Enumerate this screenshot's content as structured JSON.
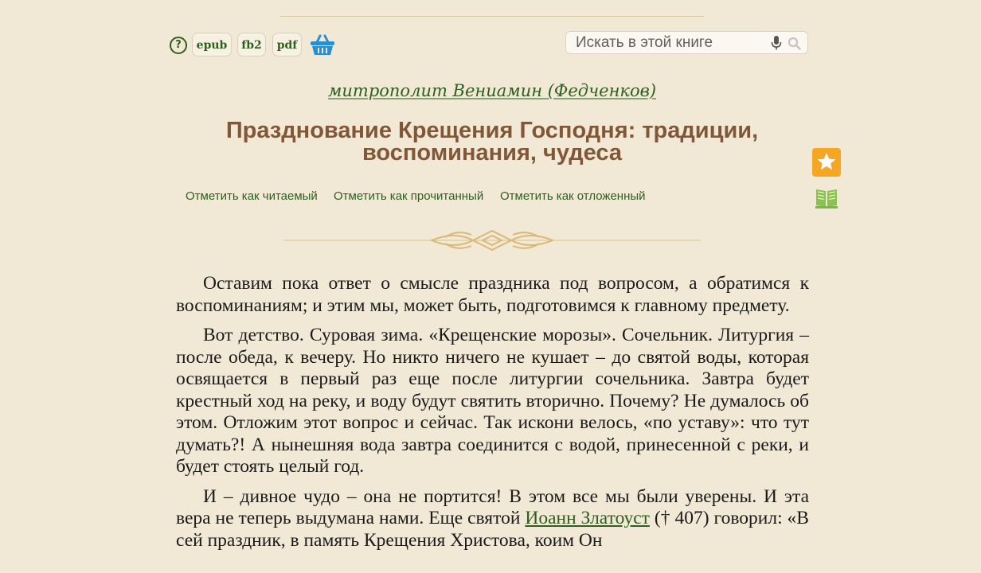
{
  "toolbar": {
    "help_icon": "question-circle-icon",
    "epub_label": "epub",
    "fb2_label": "fb2",
    "pdf_label": "pdf",
    "basket_icon": "basket-icon"
  },
  "search": {
    "placeholder": "Искать в этой книге",
    "mic_icon": "microphone-icon",
    "search_icon": "search-icon"
  },
  "book": {
    "author": "митрополит Вениамин (Федченков)",
    "title": "Празднование Крещения Господня: традиции, воспоминания, чудеса"
  },
  "actions": {
    "mark_reading": "Отметить как читаемый",
    "mark_read": "Отметить как прочитанный",
    "mark_postponed": "Отметить как отложенный",
    "favorite_icon": "star-icon",
    "reading_icon": "open-book-icon"
  },
  "content": {
    "p1": "Оставим пока ответ о смысле праздника под вопросом, а обратимся к воспоминаниям; и этим мы, может быть, подготовимся к главному предмету.",
    "p2": "Вот детство. Суровая зима. «Крещенские морозы». Сочельник. Литургия – после обеда, к вечеру. Но никто ничего не кушает – до святой воды, которая освящается в первый раз еще после литургии сочельника. Завтра будет крестный ход на реку, и воду будут святить вторично. Почему? Не думалось об этом. Отложим этот вопрос и сейчас. Так искони велось, «по уставу»: что тут думать?! А нынешняя вода завтра соединится с водой, принесенной с реки, и будет стоять целый год.",
    "p3_before": "И – дивное чудо – она не портится! В этом все мы были уверены. И эта вера не теперь выдумана нами. Еще святой ",
    "p3_link": "Иоанн Златоуст",
    "p3_after": " (†  407) говорил: «В сей праздник, в память Крещения Христова, коим Он"
  },
  "colors": {
    "background": "#f2e8d6",
    "link": "#2f5f1e",
    "title": "#805838",
    "favorite": "#f5a623",
    "basket": "#2a8fd0"
  }
}
